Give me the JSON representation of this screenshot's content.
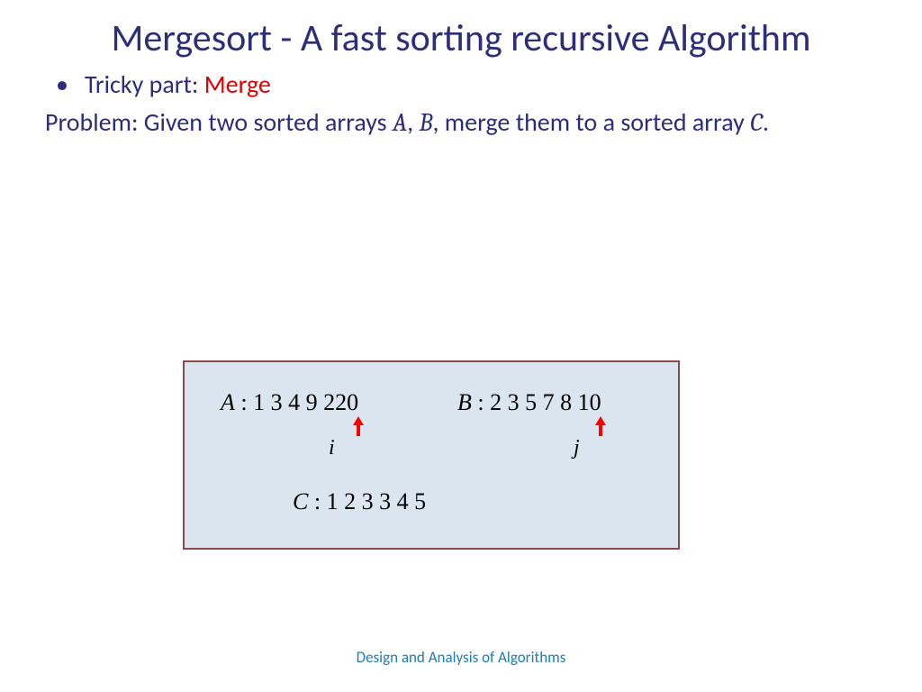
{
  "title": "Mergesort - A fast sorting recursive Algorithm",
  "bullet": {
    "prefix": "Tricky part: ",
    "highlight": "Merge"
  },
  "problem": {
    "p1": "Problem: Given two sorted arrays ",
    "varA": "A",
    "comma": ", ",
    "varB": "B",
    "p2": ", merge them to a sorted array ",
    "varC": "C",
    "period": "."
  },
  "diagram": {
    "A_label": "A",
    "A_values": " : 1 3 4 9 220",
    "B_label": "B",
    "B_values": " : 2 3 5 7 8 10",
    "C_label": "C",
    "C_values": " : 1 2 3 3 4 5",
    "i_label": "i",
    "j_label": "j"
  },
  "footer": "Design and Analysis of Algorithms"
}
